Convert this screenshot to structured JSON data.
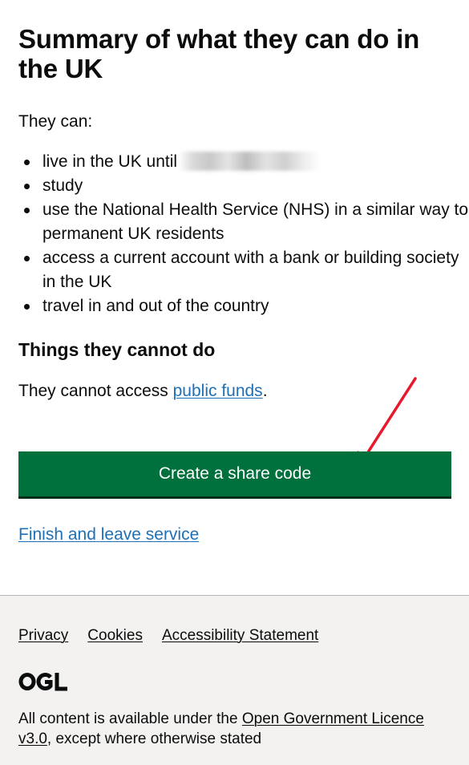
{
  "page": {
    "title": "Summary of what they can do in the UK",
    "lead": "They can:",
    "can_items": [
      "live in the UK until",
      "study",
      "use the National Health Service (NHS) in a similar way to permanent UK residents",
      "access a current account with a bank or building society in the UK",
      "travel in and out of the country"
    ],
    "cannot_heading": "Things they cannot do",
    "cannot_text_before": "They cannot access ",
    "cannot_link": "public funds",
    "cannot_text_after": ".",
    "primary_button": "Create a share code",
    "finish_link": "Finish and leave service"
  },
  "footer": {
    "links": [
      "Privacy",
      "Cookies",
      "Accessibility Statement"
    ],
    "logo_text": "OGL",
    "licence_before": "All content is available under the ",
    "licence_link": "Open Government Licence v3.0",
    "licence_after": ", except where otherwise stated"
  },
  "colors": {
    "button": "#00703c",
    "link": "#1d70b8",
    "annotation_arrow": "#e8192c",
    "footer_bg": "#f3f2f1"
  }
}
